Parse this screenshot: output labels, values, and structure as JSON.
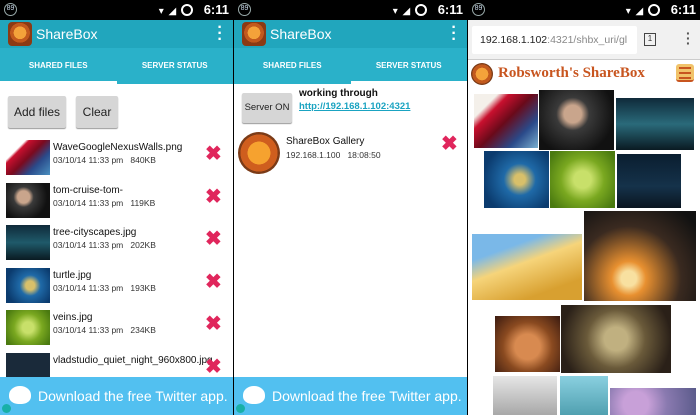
{
  "status_bar": {
    "time": "6:11",
    "notif_badge": "89"
  },
  "app": {
    "title": "ShareBox"
  },
  "tabs": {
    "shared": "SHARED FILES",
    "server": "SERVER STATUS"
  },
  "panel1": {
    "add_button": "Add files",
    "clear_button": "Clear",
    "files": [
      {
        "name": "WaveGoogleNexusWalls.png",
        "date": "03/10/14 11:33 pm",
        "size": "840KB"
      },
      {
        "name": "tom-cruise-tom-",
        "date": "03/10/14 11:33 pm",
        "size": "119KB"
      },
      {
        "name": "tree-cityscapes.jpg",
        "date": "03/10/14 11:33 pm",
        "size": "202KB"
      },
      {
        "name": "turtle.jpg",
        "date": "03/10/14 11:33 pm",
        "size": "193KB"
      },
      {
        "name": "veins.jpg",
        "date": "03/10/14 11:33 pm",
        "size": "234KB"
      },
      {
        "name": "vladstudio_quiet_night_960x800.jpg",
        "date": "",
        "size": ""
      }
    ]
  },
  "panel2": {
    "server_button": "Server ON",
    "working_label": "working through",
    "server_url": "http://192.168.1.102:4321",
    "gallery_name": "ShareBox Gallery",
    "gallery_ip": "192.168.1.100",
    "gallery_time": "18:08:50"
  },
  "twitter_banner": "Download the free Twitter app.",
  "browser": {
    "url_host": "192.168.1.102",
    "url_rest": ":4321/shbx_uri/gl",
    "tab_count": "1",
    "page_title": "Robsworth's ShareBox"
  },
  "colors": {
    "appbar": "#21a6bd",
    "tabbar": "#2ab1c9",
    "delete": "#e0265c",
    "link": "#1aa3c1",
    "twitter": "#52c0f0",
    "page_title": "#c8551f"
  }
}
